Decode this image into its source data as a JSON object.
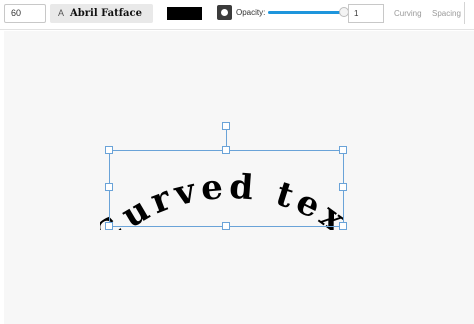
{
  "toolbar": {
    "font_size": "60",
    "font_icon": "A",
    "font_name": "Abril Fatface",
    "text_color": "#000000",
    "opacity_label": "Opacity:",
    "opacity_value": "1",
    "opacity_level": 1.0,
    "curving_label": "Curving",
    "spacing_label": "Spacing"
  },
  "canvas": {
    "text": "Curved text"
  },
  "colors": {
    "accent": "#1e95dc",
    "selection": "#6aa3d8"
  }
}
